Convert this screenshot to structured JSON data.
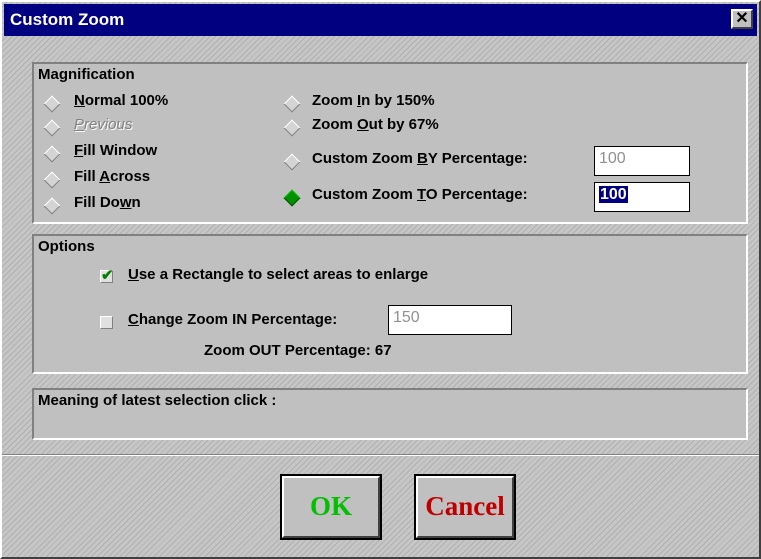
{
  "window": {
    "title": "Custom Zoom",
    "close_label": "✕"
  },
  "magnification": {
    "label": "Magnification",
    "options": [
      {
        "pre": "",
        "key": "N",
        "post": "ormal 100%",
        "selected": false,
        "disabled": false
      },
      {
        "pre": "",
        "key": "P",
        "post": "revious",
        "selected": false,
        "disabled": true
      },
      {
        "pre": "",
        "key": "F",
        "post": "ill Window",
        "selected": false,
        "disabled": false
      },
      {
        "pre": "Fill ",
        "key": "A",
        "post": "cross",
        "selected": false,
        "disabled": false
      },
      {
        "pre": "Fill Do",
        "key": "w",
        "post": "n",
        "selected": false,
        "disabled": false
      },
      {
        "pre": "Zoom ",
        "key": "I",
        "post": "n by  150%",
        "selected": false,
        "disabled": false
      },
      {
        "pre": "Zoom ",
        "key": "O",
        "post": "ut by  67%",
        "selected": false,
        "disabled": false
      },
      {
        "pre": "Custom Zoom ",
        "key": "B",
        "post": "Y Percentage:",
        "selected": false,
        "disabled": false
      },
      {
        "pre": "Custom Zoom ",
        "key": "T",
        "post": "O Percentage:",
        "selected": true,
        "disabled": false
      }
    ],
    "by_percentage_value": "100",
    "to_percentage_value": "100"
  },
  "options": {
    "label": "Options",
    "rectangle": {
      "pre": "",
      "key": "U",
      "post": "se a Rectangle to select areas to enlarge",
      "checked": true
    },
    "change_zoom_in": {
      "pre": "",
      "key": "C",
      "post": "hange Zoom IN Percentage:",
      "checked": false
    },
    "zoom_in_value": "150",
    "zoom_out_text": "Zoom OUT Percentage: 67"
  },
  "meaning": {
    "label": "Meaning of latest selection click :"
  },
  "buttons": {
    "ok_label": "OK",
    "ok_color": "#00c000",
    "cancel_label": "Cancel",
    "cancel_color": "#c00000"
  }
}
